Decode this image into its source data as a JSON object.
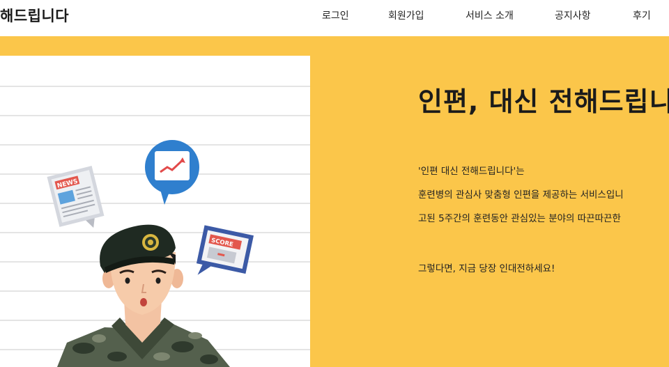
{
  "header": {
    "brand": "해드립니다",
    "nav": [
      "로그인",
      "회원가입",
      "서비스 소개",
      "공지사항",
      "후기"
    ]
  },
  "hero": {
    "headline": "인편, 대신 전해드립니",
    "lines": [
      "'인편 대신 전해드립니다'는",
      "훈련병의 관심사 맞춤형 인편을 제공하는 서비스입니",
      "고된 5주간의 훈련동안 관심있는 분야의 따끈따끈한",
      "그렇다면, 지금 당장 인대전하세요!"
    ],
    "illustration": {
      "news_label": "NEWS",
      "score_label": "SCORE"
    }
  },
  "colors": {
    "accent": "#fbc64a",
    "chart_bubble": "#2f7fce",
    "beret": "#1f2a22"
  },
  "icons": [
    "chart-bubble-icon",
    "newspaper-icon",
    "scoreboard-icon"
  ]
}
